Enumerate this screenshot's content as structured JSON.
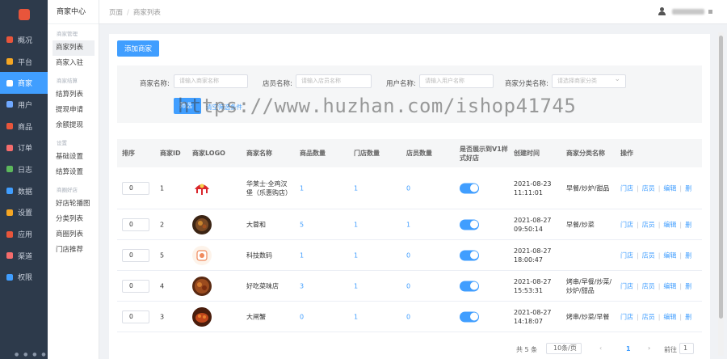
{
  "colors": {
    "nav_bg": "#2d3a4b",
    "accent": "#409eff",
    "page_bg": "#f0f2f5"
  },
  "nav": [
    {
      "label": "概况",
      "icon": "overview-icon",
      "color": "#e8553b"
    },
    {
      "label": "平台",
      "icon": "platform-icon",
      "color": "#f5a623"
    },
    {
      "label": "商家",
      "icon": "merchant-icon",
      "color": "#ffffff",
      "active": true
    },
    {
      "label": "用户",
      "icon": "user-icon",
      "color": "#6fa8ff"
    },
    {
      "label": "商品",
      "icon": "goods-icon",
      "color": "#e8553b"
    },
    {
      "label": "订单",
      "icon": "order-icon",
      "color": "#f56c6c"
    },
    {
      "label": "日志",
      "icon": "log-icon",
      "color": "#5cb85c"
    },
    {
      "label": "数据",
      "icon": "data-icon",
      "color": "#409eff"
    },
    {
      "label": "设置",
      "icon": "settings-icon",
      "color": "#f5a623"
    },
    {
      "label": "应用",
      "icon": "apps-icon",
      "color": "#e8553b"
    },
    {
      "label": "渠道",
      "icon": "channel-icon",
      "color": "#f56c6c"
    },
    {
      "label": "权限",
      "icon": "permission-icon",
      "color": "#409eff"
    }
  ],
  "sub_nav": {
    "title": "商家中心",
    "groups": [
      {
        "label": "商家管理",
        "items": [
          "商家列表",
          "商家入驻"
        ]
      },
      {
        "label": "商家结算",
        "items": [
          "结算列表",
          "提现申请",
          "余额提现"
        ]
      },
      {
        "label": "设置",
        "items": [
          "基础设置",
          "结算设置"
        ]
      },
      {
        "label": "商圈好店",
        "items": [
          "好店轮播图",
          "分类列表",
          "商圈列表",
          "门店推荐"
        ]
      }
    ]
  },
  "header": {
    "breadcrumb_root": "页面",
    "breadcrumb_current": "商家列表"
  },
  "toolbar": {
    "add_label": "添加商家"
  },
  "filters": {
    "merchant_name_label": "商家名称:",
    "merchant_name_placeholder": "请输入商家名称",
    "shop_name_label": "店员名称:",
    "shop_name_placeholder": "请输入店员名称",
    "user_name_label": "用户名称:",
    "user_name_placeholder": "请输入用户名称",
    "category_label": "商家分类名称:",
    "category_placeholder": "请选择商家分类",
    "search_label": "筛选",
    "clear_label": "清空筛选条件"
  },
  "watermark": "https://www.huzhan.com/ishop41745",
  "table": {
    "headers": [
      "排序",
      "商家ID",
      "商家LOGO",
      "商家名称",
      "商品数量",
      "门店数量",
      "店员数量",
      "是否展示到V1样式好店",
      "创建时间",
      "商家分类名称",
      "操作"
    ],
    "actions": [
      "门店",
      "店员",
      "编辑",
      "删"
    ],
    "rows": [
      {
        "sort": "0",
        "id": "1",
        "logo": "logo-red-umbrella",
        "name": "华莱士·全鸡汉堡（乐惠购店）",
        "goods": "1",
        "stores": "1",
        "clerks": "0",
        "v1": true,
        "created": "2021-08-23 11:11:01",
        "category": "早餐/炒炉/甜品"
      },
      {
        "sort": "0",
        "id": "2",
        "logo": "logo-dish-dark",
        "name": "大蓉和",
        "goods": "5",
        "stores": "1",
        "clerks": "1",
        "v1": true,
        "created": "2021-08-27 09:50:14",
        "category": "早餐/炒菜"
      },
      {
        "sort": "0",
        "id": "5",
        "logo": "logo-tech-badge",
        "name": "科技数码",
        "goods": "1",
        "stores": "1",
        "clerks": "0",
        "v1": true,
        "created": "2021-08-27 18:00:47",
        "category": ""
      },
      {
        "sort": "0",
        "id": "4",
        "logo": "logo-dish-brown",
        "name": "好吃菜味店",
        "goods": "3",
        "stores": "1",
        "clerks": "0",
        "v1": true,
        "created": "2021-08-27 15:53:31",
        "category": "烤串/早餐/炒菜/炒炉/甜品"
      },
      {
        "sort": "0",
        "id": "3",
        "logo": "logo-crab",
        "name": "大闸蟹",
        "goods": "0",
        "stores": "1",
        "clerks": "0",
        "v1": true,
        "created": "2021-08-27 14:18:07",
        "category": "烤串/炒菜/早餐"
      }
    ]
  },
  "pager": {
    "total": "共 5 条",
    "page_size": "10条/页",
    "prev": "‹",
    "page": "1",
    "next": "›",
    "goto_label": "前往",
    "goto_value": "1"
  }
}
